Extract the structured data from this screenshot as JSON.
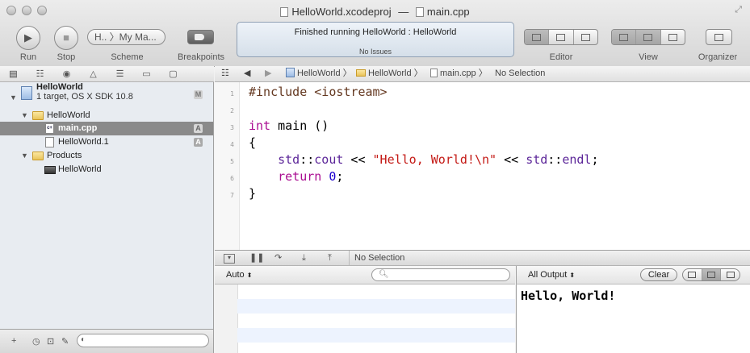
{
  "window": {
    "project_file": "HelloWorld.xcodeproj",
    "separator": "—",
    "current_file": "main.cpp"
  },
  "toolbar": {
    "run_label": "Run",
    "stop_label": "Stop",
    "scheme_value": "H.. 〉My Ma...",
    "scheme_label": "Scheme",
    "breakpoints_label": "Breakpoints",
    "editor_label": "Editor",
    "view_label": "View",
    "organizer_label": "Organizer"
  },
  "status": {
    "message": "Finished running HelloWorld : HelloWorld",
    "issues": "No Issues"
  },
  "navigator": {
    "project": {
      "name": "HelloWorld",
      "subtitle": "1 target, OS X SDK 10.8",
      "badge": "M"
    },
    "items": [
      {
        "label": "HelloWorld",
        "kind": "folder"
      },
      {
        "label": "main.cpp",
        "kind": "cpp-file",
        "badge": "A",
        "selected": true
      },
      {
        "label": "HelloWorld.1",
        "kind": "doc-file",
        "badge": "A"
      },
      {
        "label": "Products",
        "kind": "folder"
      },
      {
        "label": "HelloWorld",
        "kind": "product"
      }
    ]
  },
  "jumpbar": {
    "crumbs": [
      "HelloWorld",
      "HelloWorld",
      "main.cpp",
      "No Selection"
    ]
  },
  "editor": {
    "line_numbers": [
      "1",
      "2",
      "3",
      "4",
      "5",
      "6",
      "7"
    ],
    "lines": [
      [
        {
          "t": "#include <iostream>",
          "c": "pp"
        }
      ],
      [],
      [
        {
          "t": "int",
          "c": "kw"
        },
        {
          "t": " main ()",
          "c": ""
        }
      ],
      [
        {
          "t": "{",
          "c": ""
        }
      ],
      [
        {
          "t": "    ",
          "c": ""
        },
        {
          "t": "std",
          "c": "ty"
        },
        {
          "t": "::",
          "c": ""
        },
        {
          "t": "cout",
          "c": "ty"
        },
        {
          "t": " << ",
          "c": ""
        },
        {
          "t": "\"Hello, World!\\n\"",
          "c": "str"
        },
        {
          "t": " << ",
          "c": ""
        },
        {
          "t": "std",
          "c": "ty"
        },
        {
          "t": "::",
          "c": ""
        },
        {
          "t": "endl",
          "c": "ty"
        },
        {
          "t": ";",
          "c": ""
        }
      ],
      [
        {
          "t": "    ",
          "c": ""
        },
        {
          "t": "return",
          "c": "kw"
        },
        {
          "t": " ",
          "c": ""
        },
        {
          "t": "0",
          "c": "num"
        },
        {
          "t": ";",
          "c": ""
        }
      ],
      [
        {
          "t": "}",
          "c": ""
        }
      ]
    ]
  },
  "debug": {
    "selection": "No Selection"
  },
  "variables": {
    "scope": "Auto ⌃",
    "scope_display": "Auto",
    "search_placeholder": ""
  },
  "console": {
    "filter": "All Output",
    "clear_label": "Clear",
    "output": "Hello, World!"
  }
}
